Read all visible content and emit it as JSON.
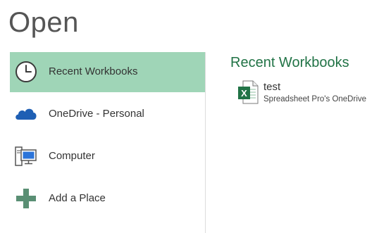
{
  "page": {
    "title": "Open"
  },
  "nav": {
    "items": [
      {
        "label": "Recent Workbooks",
        "icon": "clock-icon",
        "selected": true
      },
      {
        "label": "OneDrive - Personal",
        "icon": "cloud-icon",
        "selected": false
      },
      {
        "label": "Computer",
        "icon": "computer-icon",
        "selected": false
      },
      {
        "label": "Add a Place",
        "icon": "plus-icon",
        "selected": false
      }
    ]
  },
  "recent": {
    "title": "Recent Workbooks",
    "files": [
      {
        "name": "test",
        "location": "Spreadsheet Pro's OneDrive",
        "icon": "excel-file-icon"
      }
    ]
  },
  "colors": {
    "accent": "#217346",
    "selected_bg": "#9fd5b7",
    "cloud": "#1e5fb4",
    "plus": "#5a8f74"
  }
}
